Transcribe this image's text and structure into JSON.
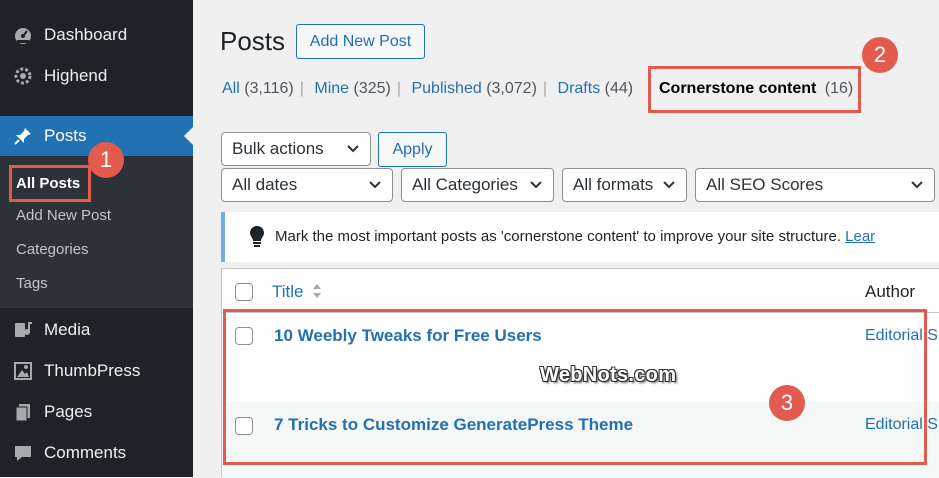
{
  "sidebar": {
    "items": [
      {
        "label": "Dashboard",
        "icon": "dashboard-icon"
      },
      {
        "label": "Highend",
        "icon": "highend-icon"
      },
      {
        "label": "Posts",
        "icon": "pushpin-icon"
      },
      {
        "label": "Media",
        "icon": "media-icon"
      },
      {
        "label": "ThumbPress",
        "icon": "image-icon"
      },
      {
        "label": "Pages",
        "icon": "pages-icon"
      },
      {
        "label": "Comments",
        "icon": "comments-icon"
      }
    ],
    "posts_submenu": [
      "All Posts",
      "Add New Post",
      "Categories",
      "Tags"
    ]
  },
  "header": {
    "title": "Posts",
    "add_new_label": "Add New Post"
  },
  "views": [
    {
      "label": "All",
      "count": "(3,116)"
    },
    {
      "label": "Mine",
      "count": "(325)"
    },
    {
      "label": "Published",
      "count": "(3,072)"
    },
    {
      "label": "Drafts",
      "count": "(44)"
    },
    {
      "label": "Cornerstone content",
      "count": "(16)"
    }
  ],
  "filters": {
    "bulk_actions": "Bulk actions",
    "apply": "Apply",
    "dates": "All dates",
    "categories": "All Categories",
    "formats": "All formats",
    "seo": "All SEO Scores"
  },
  "notice": {
    "text": "Mark the most important posts as 'cornerstone content' to improve your site structure.",
    "link": "Lear"
  },
  "table": {
    "col_title": "Title",
    "col_author": "Author",
    "rows": [
      {
        "title": "10 Weebly Tweaks for Free Users",
        "author": "Editorial S"
      },
      {
        "title": "7 Tricks to Customize GeneratePress Theme",
        "author": "Editorial S"
      }
    ]
  },
  "annotations": {
    "badge1": "1",
    "badge2": "2",
    "badge3": "3"
  },
  "watermark": "WebNots.com",
  "colors": {
    "accent": "#2271b1",
    "callout": "#e35b4f",
    "sidebar": "#1d2327"
  }
}
